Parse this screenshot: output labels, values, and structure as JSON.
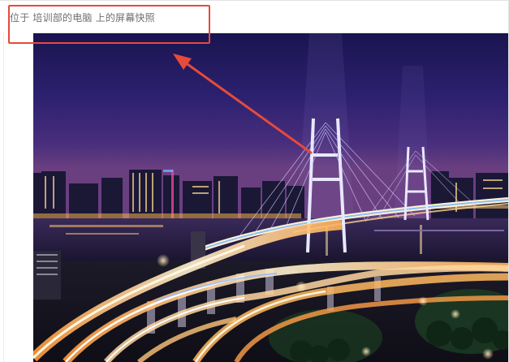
{
  "window": {
    "title": "位于 培训部的电脑 上的屏幕快照"
  },
  "photo": {
    "subject": "city-bridge-night-photo"
  },
  "annotation": {
    "box_color": "#e64a3b",
    "arrow_color": "#e64a3b"
  }
}
